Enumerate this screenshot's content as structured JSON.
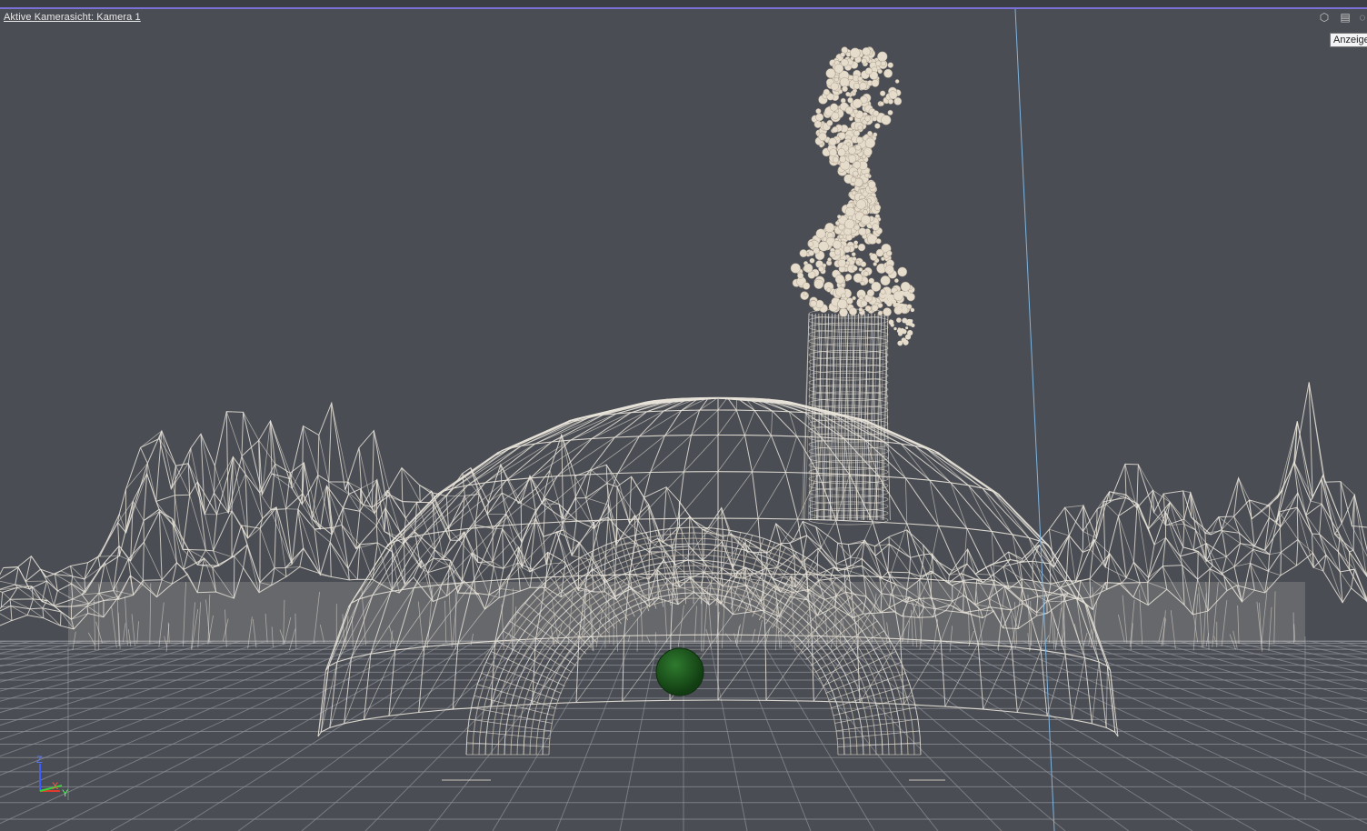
{
  "viewport": {
    "camera_label": "Aktive Kamerasicht: Kamera 1",
    "tooltip": "Anzeige",
    "icons": [
      "display-mode-icon",
      "viewport-layout-icon",
      "viewport-options-icon"
    ]
  },
  "axis_gizmo": {
    "z": "Z",
    "x": "X",
    "y": "Y",
    "colors": {
      "z": "#3e5cff",
      "x": "#e03a2a",
      "y": "#3ad23a"
    }
  },
  "scene": {
    "background": "#4a4d53",
    "wire_color": "#e9e4da",
    "grid_color": "#8d9097",
    "sphere_color": "#1f5c1f"
  }
}
